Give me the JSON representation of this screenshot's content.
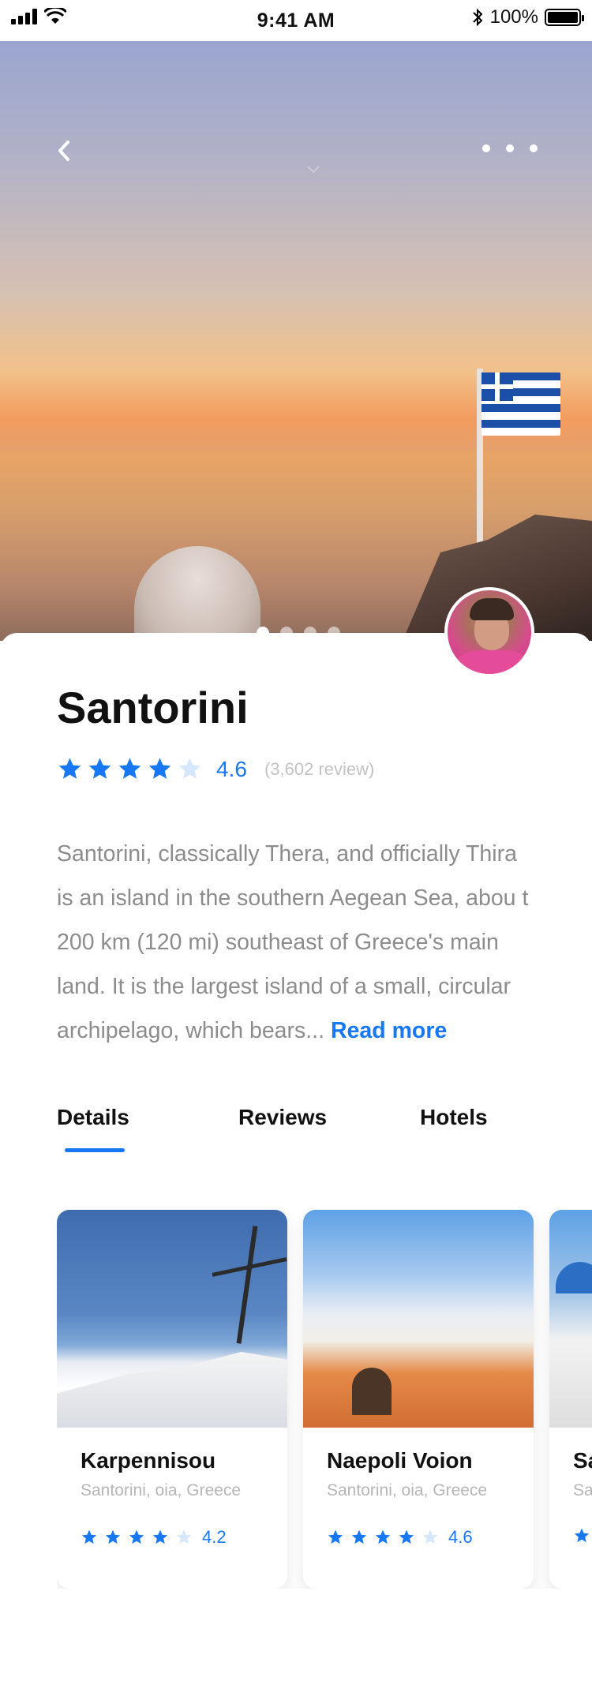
{
  "status_bar": {
    "time": "9:41 AM",
    "battery": "100%",
    "battery_level": 1.0
  },
  "hero": {
    "current_slide": 1,
    "slide_count": 4
  },
  "place": {
    "title": "Santorini",
    "rating": "4.6",
    "rating_value": 4.6,
    "reviews": "(3,602 review)",
    "description": "Santorini, classically Thera, and officially Thira is an island in the southern Aegean Sea, abou t 200 km (120 mi) southeast of Greece's main land. It is the largest island of a small, circular archipelago, which bears...",
    "read_more": "Read more"
  },
  "tabs": [
    {
      "label": "Details",
      "active": true
    },
    {
      "label": "Reviews",
      "active": false
    },
    {
      "label": "Hotels",
      "active": false
    }
  ],
  "cards": [
    {
      "name": "Karpennisou",
      "location": "Santorini, oia, Greece",
      "rating": "4.2",
      "stars": 4
    },
    {
      "name": "Naepoli Voion",
      "location": "Santorini, oia, Greece",
      "rating": "4.6",
      "stars": 4
    },
    {
      "name": "Sa",
      "location": "Sa",
      "rating": "",
      "stars": 1
    }
  ],
  "colors": {
    "accent": "#1877f2",
    "star_empty": "#d6e6fb"
  },
  "icons": [
    "back-chevron-icon",
    "more-dots-icon",
    "swipe-down-chevron-icon",
    "star-icon",
    "wifi-icon",
    "cellular-signal-icon",
    "bluetooth-icon",
    "battery-icon"
  ]
}
